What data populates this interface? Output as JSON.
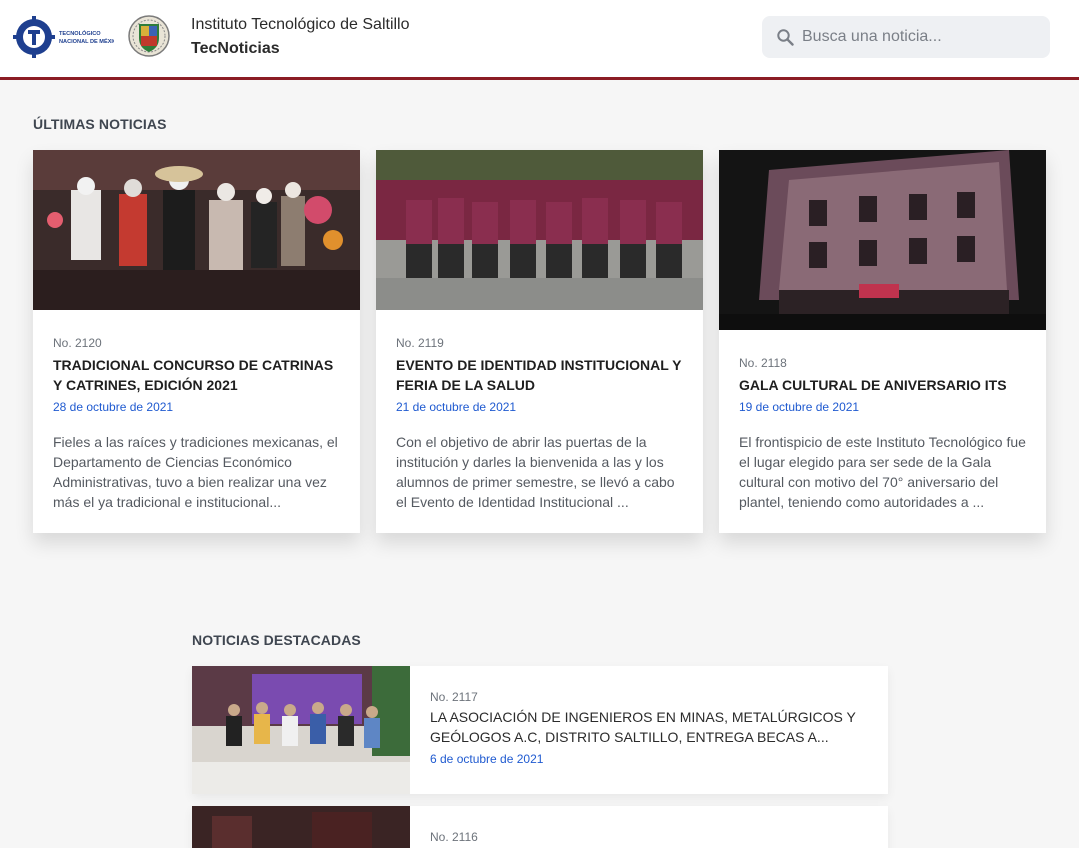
{
  "header": {
    "institution": "Instituto Tecnológico de Saltillo",
    "site_name": "TecNoticias",
    "tnm_logo_text": [
      "TECNOLÓGICO",
      "NACIONAL DE MÉXICO"
    ],
    "search_placeholder": "Busca una noticia..."
  },
  "colors": {
    "accent": "#8b1d24",
    "date": "#1f5ad0",
    "background": "#f6f6f6"
  },
  "latest": {
    "title": "ÚLTIMAS NOTICIAS",
    "cards": [
      {
        "number": "No. 2120",
        "title": "TRADICIONAL CONCURSO DE CATRINAS Y CATRINES, EDICIÓN 2021",
        "date": "28 de octubre de 2021",
        "excerpt": "Fieles a las raíces y tradiciones mexicanas, el Departamento de Ciencias Económico Administrativas, tuvo a bien realizar una vez más el ya tradicional e institucional..."
      },
      {
        "number": "No. 2119",
        "title": "EVENTO DE IDENTIDAD INSTITUCIONAL Y FERIA DE LA SALUD",
        "date": "21 de octubre de 2021",
        "excerpt": "Con el objetivo de abrir las puertas de la institución y darles la bienvenida a las y los alumnos de primer semestre, se llevó a cabo el Evento de Identidad Institucional ..."
      },
      {
        "number": "No. 2118",
        "title": "GALA CULTURAL DE ANIVERSARIO ITS",
        "date": "19 de octubre de 2021",
        "excerpt": "El frontispicio de este Instituto Tecnológico fue el lugar elegido para ser sede de la Gala cultural con motivo del 70° aniversario del plantel, teniendo como autoridades a ..."
      }
    ]
  },
  "featured": {
    "title": "NOTICIAS DESTACADAS",
    "items": [
      {
        "number": "No. 2117",
        "title": "LA ASOCIACIÓN DE INGENIEROS EN MINAS, METALÚRGICOS Y GEÓLOGOS A.C, DISTRITO SALTILLO, ENTREGA BECAS A...",
        "date": "6 de octubre de 2021"
      },
      {
        "number": "No. 2116",
        "title": "",
        "date": ""
      }
    ]
  }
}
